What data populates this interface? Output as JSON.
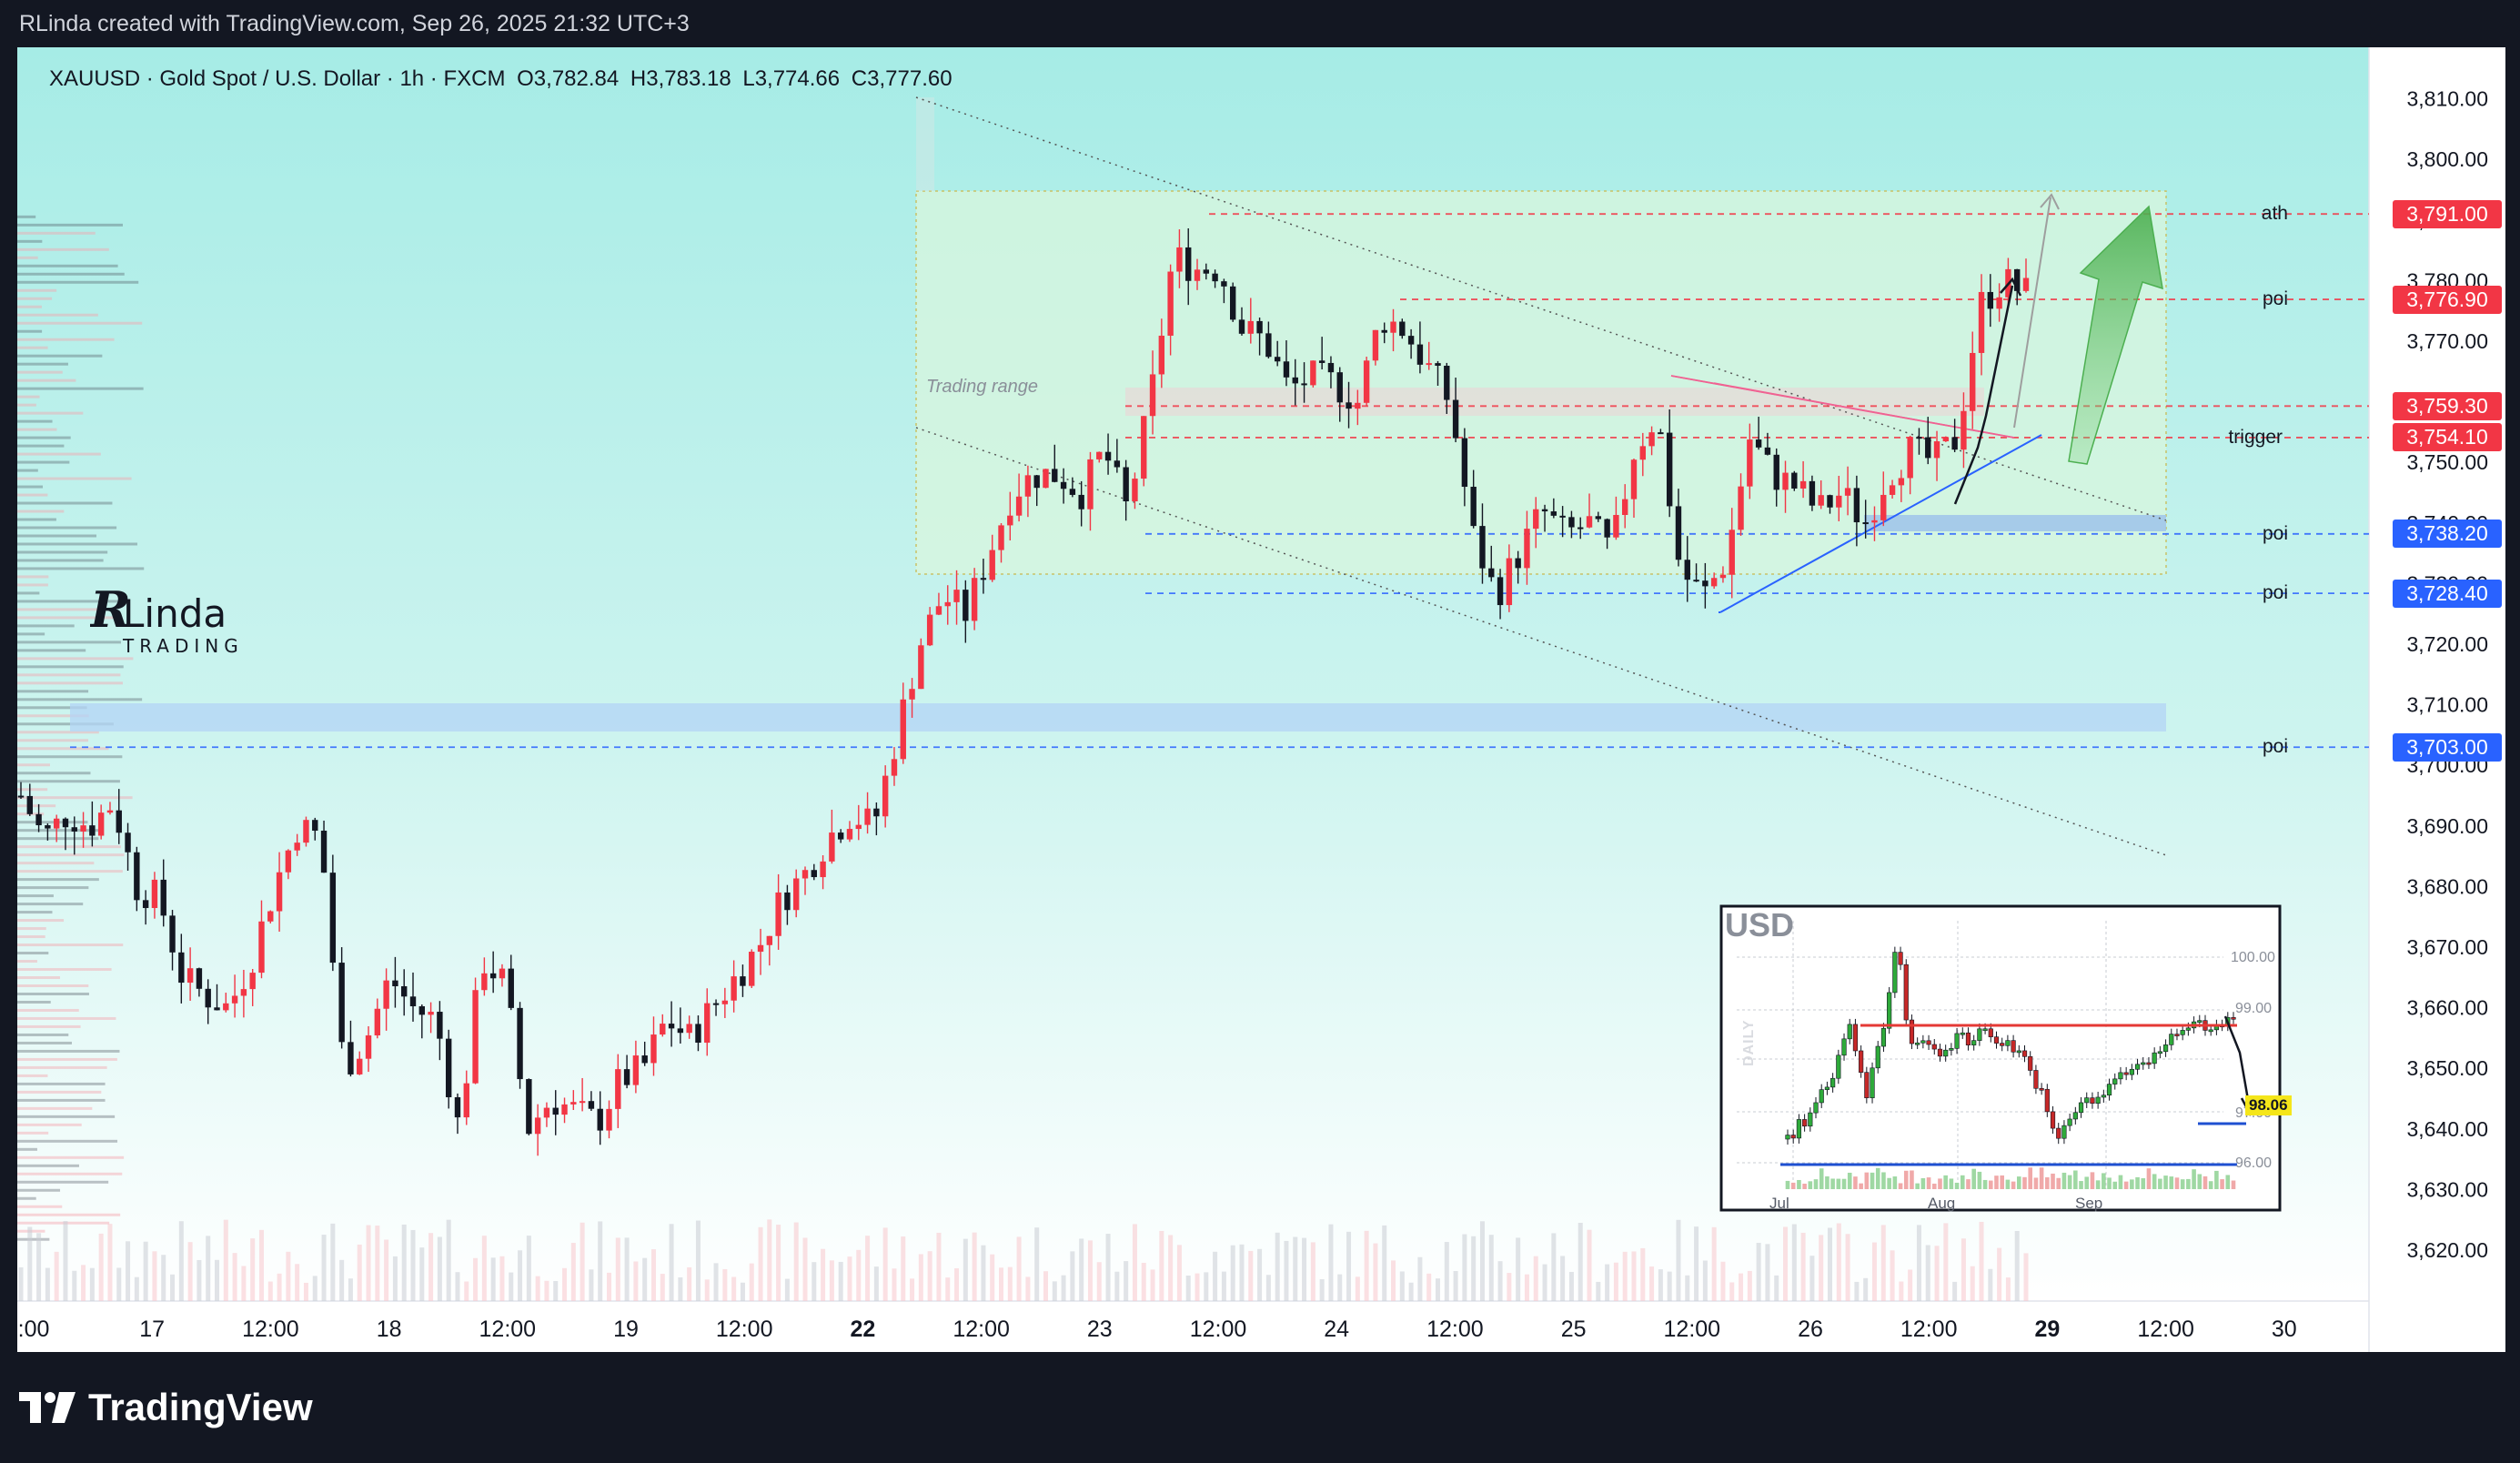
{
  "header": {
    "attribution": "RLinda created with TradingView.com, Sep 26, 2025 21:32 UTC+3"
  },
  "legend": {
    "symbol": "XAUUSD · Gold Spot / U.S. Dollar · 1h · FXCM",
    "open": "O3,782.84",
    "high": "H3,783.18",
    "low": "L3,774.66",
    "close": "C3,777.60"
  },
  "annotations": {
    "trading_range": "Trading range",
    "ath_label": "ath",
    "poi_label": "poi",
    "trigger_label": "trigger"
  },
  "price_tags": [
    {
      "label": "ath",
      "value": "3,791.00",
      "price": 3791.0,
      "color": "red"
    },
    {
      "label": "poi",
      "value": "3,776.90",
      "price": 3776.9,
      "color": "red"
    },
    {
      "label": "",
      "value": "3,759.30",
      "price": 3759.3,
      "color": "red"
    },
    {
      "label": "trigger",
      "value": "3,754.10",
      "price": 3754.1,
      "color": "red"
    },
    {
      "label": "poi",
      "value": "3,738.20",
      "price": 3738.2,
      "color": "blue"
    },
    {
      "label": "poi",
      "value": "3,728.40",
      "price": 3728.4,
      "color": "blue"
    },
    {
      "label": "poi",
      "value": "3,703.00",
      "price": 3703.0,
      "color": "blue"
    }
  ],
  "colors": {
    "bull": "#f23645",
    "bear": "#131722",
    "tag_red": "#f23645",
    "tag_blue": "#2962ff",
    "bg_top": "#a6ece6",
    "bg_bottom": "#ffffff",
    "range_fill": "#d4f0d9",
    "arrow_green": "#5cb85c"
  },
  "chart_data": {
    "type": "candlestick",
    "symbol": "XAUUSD",
    "timeframe": "1h",
    "ylim": [
      3614,
      3814
    ],
    "y_ticks": [
      "3,810.00",
      "3,800.00",
      "3,790.00",
      "3,780.00",
      "3,770.00",
      "3,760.00",
      "3,750.00",
      "3,740.00",
      "3,730.00",
      "3,720.00",
      "3,710.00",
      "3,700.00",
      "3,690.00",
      "3,680.00",
      "3,670.00",
      "3,660.00",
      "3,650.00",
      "3,640.00",
      "3,630.00",
      "3,620.00"
    ],
    "y_tick_values": [
      3810,
      3800,
      3790,
      3780,
      3770,
      3760,
      3750,
      3740,
      3730,
      3720,
      3710,
      3700,
      3690,
      3680,
      3670,
      3660,
      3650,
      3640,
      3630,
      3620
    ],
    "x_ticks": [
      {
        "label": ":00",
        "bold": false
      },
      {
        "label": "17",
        "bold": false
      },
      {
        "label": "12:00",
        "bold": false
      },
      {
        "label": "18",
        "bold": false
      },
      {
        "label": "12:00",
        "bold": false
      },
      {
        "label": "19",
        "bold": false
      },
      {
        "label": "12:00",
        "bold": false
      },
      {
        "label": "22",
        "bold": true
      },
      {
        "label": "12:00",
        "bold": false
      },
      {
        "label": "23",
        "bold": false
      },
      {
        "label": "12:00",
        "bold": false
      },
      {
        "label": "24",
        "bold": false
      },
      {
        "label": "12:00",
        "bold": false
      },
      {
        "label": "25",
        "bold": false
      },
      {
        "label": "12:00",
        "bold": false
      },
      {
        "label": "26",
        "bold": false
      },
      {
        "label": "12:00",
        "bold": false
      },
      {
        "label": "29",
        "bold": true
      },
      {
        "label": "12:00",
        "bold": false
      },
      {
        "label": "30",
        "bold": false
      }
    ],
    "key_levels": [
      3791.0,
      3776.9,
      3759.3,
      3754.1,
      3738.2,
      3728.4,
      3703.0
    ],
    "close_path": [
      3695,
      3688,
      3692,
      3690,
      3694,
      3680,
      3678,
      3665,
      3662,
      3660,
      3668,
      3680,
      3690,
      3688,
      3650,
      3655,
      3665,
      3660,
      3658,
      3640,
      3668,
      3664,
      3640,
      3645,
      3643,
      3641,
      3648,
      3650,
      3658,
      3655,
      3660,
      3665,
      3670,
      3678,
      3682,
      3688,
      3692,
      3690,
      3705,
      3720,
      3728,
      3725,
      3735,
      3745,
      3748,
      3748,
      3745,
      3752,
      3742,
      3760,
      3784,
      3782,
      3782,
      3772,
      3770,
      3762,
      3764,
      3763,
      3760,
      3774,
      3772,
      3766,
      3760,
      3738,
      3728,
      3735,
      3742,
      3738,
      3740,
      3735,
      3752,
      3758,
      3732,
      3728,
      3734,
      3754,
      3748,
      3746,
      3742,
      3745,
      3740,
      3748,
      3752,
      3750,
      3754,
      3776,
      3780,
      3778
    ]
  },
  "inset": {
    "title": "USD",
    "axis_label": "DAILY",
    "price_levels": [
      "100.00",
      "99.00",
      "97.00",
      "96.00"
    ],
    "last_price": "98.06",
    "x_labels": [
      "Jul",
      "Aug",
      "Sep"
    ]
  },
  "watermark": {
    "name": "RLinda",
    "sub": "TRADING"
  },
  "footer": {
    "brand": "TradingView"
  }
}
